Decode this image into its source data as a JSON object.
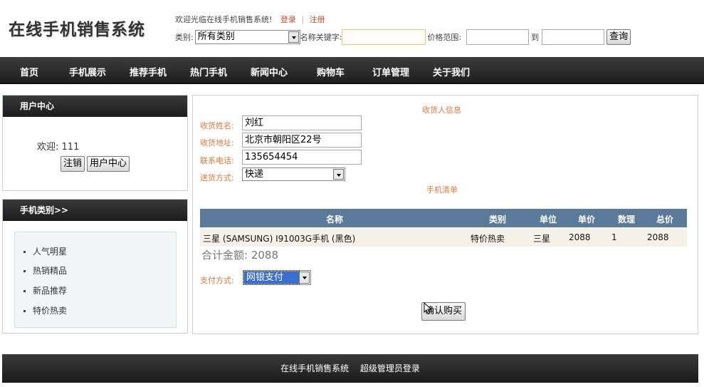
{
  "site": {
    "title": "在线手机销售系统"
  },
  "header": {
    "welcome": "欢迎光临在线手机销售系统!",
    "login": "登录",
    "sep": "|",
    "register": "注册",
    "category_label": "类别:",
    "category_value": "所有类别",
    "keyword_label": "名称关键字:",
    "keyword_value": "",
    "price_label": "价格范围:",
    "price_to": "到",
    "price_min": "",
    "price_max": "",
    "search_button": "查询"
  },
  "nav": [
    "首页",
    "手机展示",
    "推荐手机",
    "热门手机",
    "新闻中心",
    "购物车",
    "订单管理",
    "关于我们"
  ],
  "user_center": {
    "title": "用户中心",
    "welcome": "欢迎:",
    "username": "111",
    "logout_button": "注销",
    "center_button": "用户中心"
  },
  "categories": {
    "title": "手机类别>>",
    "items": [
      "人气明星",
      "热销精品",
      "新品推荐",
      "特价热卖"
    ]
  },
  "recipient": {
    "title": "收货人信息",
    "name_label": "收货姓名:",
    "name_value": "刘红",
    "address_label": "收货地址:",
    "address_value": "北京市朝阳区22号",
    "phone_label": "联系电话:",
    "phone_value": "135654454",
    "delivery_label": "送货方式:",
    "delivery_value": "快递"
  },
  "order": {
    "title": "手机清单",
    "columns": [
      "名称",
      "类别",
      "单位",
      "单价",
      "数理",
      "总价"
    ],
    "rows": [
      {
        "name": "三星 (SAMSUNG) I91003G手机 (黑色)",
        "category": "特价热卖",
        "unit": "三星",
        "price": "2088",
        "qty": "1",
        "total": "2088"
      }
    ],
    "total_label": "合计金额:",
    "total_value": "2088",
    "payment_label": "支付方式:",
    "payment_value": "网银支付",
    "confirm_button": "确认购买"
  },
  "footer": {
    "system_name": "在线手机销售系统",
    "admin_link": "超级管理员登录"
  }
}
